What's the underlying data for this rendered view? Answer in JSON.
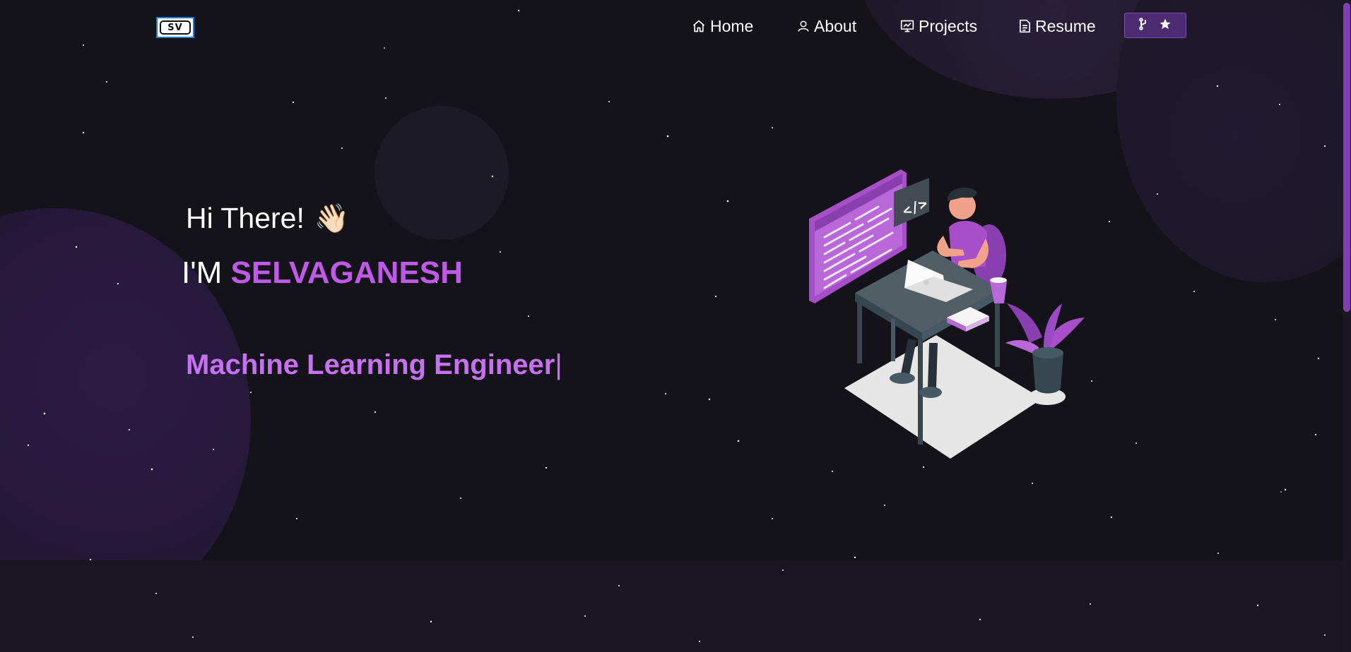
{
  "brand": {
    "logo_text": "SV"
  },
  "nav": {
    "items": [
      {
        "label": "Home",
        "icon": "home-icon"
      },
      {
        "label": "About",
        "icon": "user-icon"
      },
      {
        "label": "Projects",
        "icon": "projects-icon"
      },
      {
        "label": "Resume",
        "icon": "document-icon"
      }
    ],
    "fork_button": {
      "icons": [
        "git-fork-icon",
        "star-icon"
      ]
    }
  },
  "hero": {
    "greeting": "Hi There!",
    "greeting_emoji": "👋🏻",
    "intro_prefix": "I'M",
    "name": "SELVAGANESH",
    "role": "Machine Learning Engineer",
    "cursor": "|"
  },
  "colors": {
    "accent": "#c770f0",
    "background": "#141319",
    "fork_button": "#4d2b73"
  }
}
